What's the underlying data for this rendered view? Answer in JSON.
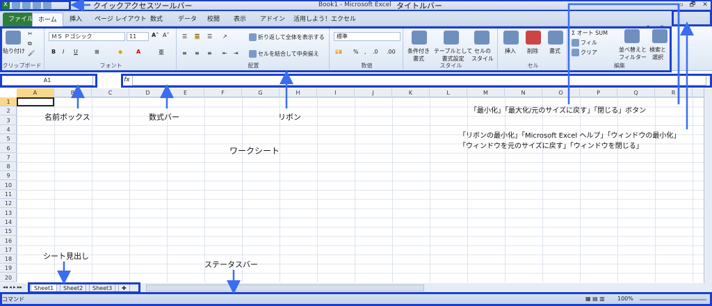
{
  "window": {
    "title": "Book1 - Microsoft Excel",
    "controls": [
      "▭",
      "🗗",
      "✕"
    ]
  },
  "ribbon": {
    "tabs": [
      "ファイル",
      "ホーム",
      "挿入",
      "ページ レイアウト",
      "数式",
      "データ",
      "校閲",
      "表示",
      "アドイン",
      "活用しよう！エクセル"
    ],
    "groups": {
      "clipboard": {
        "label": "クリップボード",
        "paste": "貼り付け"
      },
      "font": {
        "label": "フォント",
        "name": "ＭＳ Ｐゴシック",
        "size": "11",
        "bold": "B",
        "italic": "I",
        "underline": "U"
      },
      "alignment": {
        "label": "配置",
        "wrap": "折り返して全体を表示する",
        "merge": "セルを結合して中央揃え"
      },
      "number": {
        "label": "数値",
        "format": "標準",
        "percent": "%"
      },
      "styles": {
        "label": "スタイル",
        "conditional": "条件付き\n書式",
        "table": "テーブルとして\n書式設定",
        "cell": "セルの\nスタイル"
      },
      "cells": {
        "label": "セル",
        "insert": "挿入",
        "delete": "削除",
        "format": "書式"
      },
      "editing": {
        "label": "編集",
        "autosum": "オート SUM",
        "fill": "フィル",
        "clear": "クリア",
        "sort": "並べ替えと\nフィルター",
        "find": "検索と\n選択"
      }
    }
  },
  "formula_bar": {
    "name_box": "A1",
    "fx": "fx",
    "value": ""
  },
  "columns": [
    "A",
    "B",
    "C",
    "D",
    "E",
    "F",
    "G",
    "H",
    "I",
    "J",
    "K",
    "L",
    "M",
    "N",
    "O",
    "P",
    "Q",
    "R"
  ],
  "rows": [
    "1",
    "2",
    "3",
    "4",
    "5",
    "6",
    "7",
    "8",
    "9",
    "10",
    "11",
    "12",
    "13",
    "14",
    "15",
    "16",
    "17",
    "18",
    "19",
    "20"
  ],
  "sheets": [
    "Sheet1",
    "Sheet2",
    "Sheet3"
  ],
  "status": {
    "mode": "コマンド",
    "zoom": "100%"
  },
  "annotations": {
    "qat": "クイックアクセスツールバー",
    "titlebar": "タイトルバー",
    "name_box": "名前ボックス",
    "formula_bar": "数式バー",
    "ribbon": "リボン",
    "worksheet": "ワークシート",
    "window_buttons": "「最小化」「最大化/元のサイズに戻す」「閉じる」ボタン",
    "ribbon_buttons_1": "「リボンの最小化」「Microsoft Excel ヘルプ」「ウィンドウの最小化」",
    "ribbon_buttons_2": "「ウィンドウを元のサイズに戻す」「ウィンドウを閉じる」",
    "sheet_tabs": "シート見出し",
    "status_bar": "ステータスバー"
  }
}
